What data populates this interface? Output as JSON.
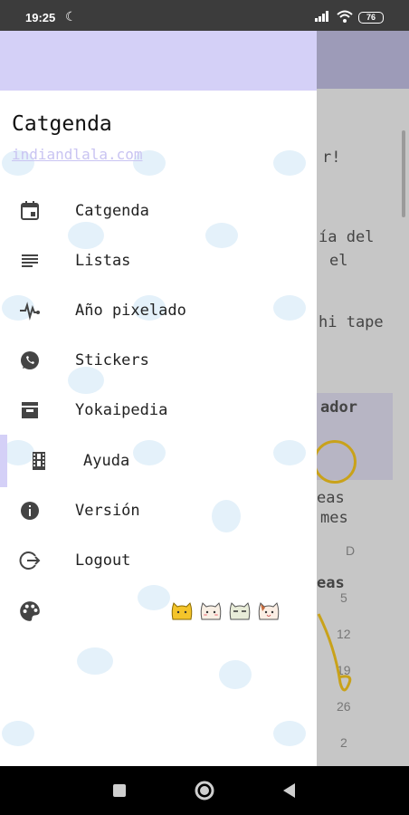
{
  "status_bar": {
    "time": "19:25",
    "battery": "76"
  },
  "drawer": {
    "title": "Catgenda",
    "link": "indiandlala.com",
    "items": [
      {
        "label": "Catgenda",
        "icon": "calendar-icon"
      },
      {
        "label": "Listas",
        "icon": "list-icon"
      },
      {
        "label": "Año pixelado",
        "icon": "pulse-icon"
      },
      {
        "label": "Stickers",
        "icon": "whatsapp-icon"
      },
      {
        "label": "Yokaipedia",
        "icon": "inbox-icon"
      },
      {
        "label": "Ayuda",
        "icon": "film-icon",
        "selected": true
      },
      {
        "label": "Versión",
        "icon": "info-icon"
      },
      {
        "label": "Logout",
        "icon": "logout-icon"
      }
    ],
    "theme_icon": "palette-icon",
    "accent_color": "#d4d0f7"
  },
  "background": {
    "texts": [
      "r!",
      "ía del",
      "el",
      "hi tape",
      "ador",
      "eas",
      "mes",
      "eas"
    ],
    "numbers": [
      "D",
      "5",
      "12",
      "19",
      "26",
      "2"
    ]
  }
}
